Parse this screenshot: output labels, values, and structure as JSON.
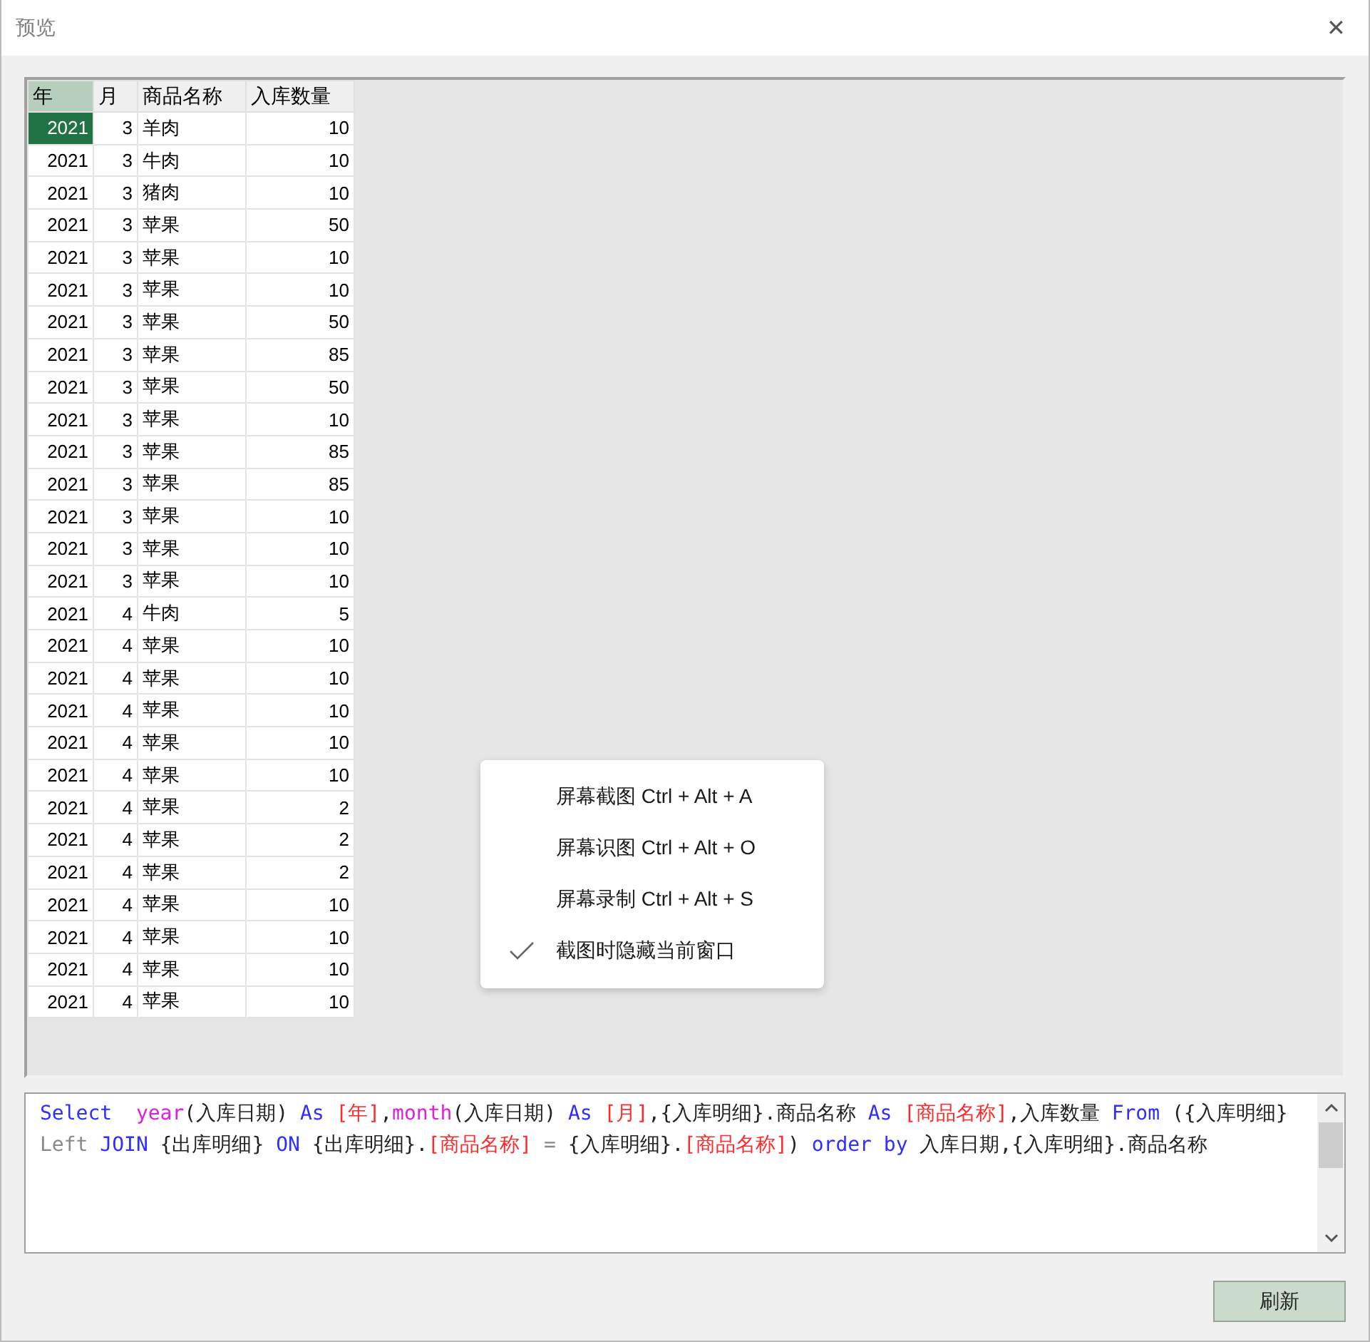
{
  "window": {
    "title": "预览",
    "close": "✕"
  },
  "table": {
    "columns": [
      {
        "label": "年",
        "selected": true
      },
      {
        "label": "月",
        "selected": false
      },
      {
        "label": "商品名称",
        "selected": false
      },
      {
        "label": "入库数量",
        "selected": false
      }
    ],
    "rows": [
      {
        "cells": [
          "2021",
          "3",
          "羊肉",
          "10"
        ],
        "selected": true
      },
      {
        "cells": [
          "2021",
          "3",
          "牛肉",
          "10"
        ],
        "selected": false
      },
      {
        "cells": [
          "2021",
          "3",
          "猪肉",
          "10"
        ],
        "selected": false
      },
      {
        "cells": [
          "2021",
          "3",
          "苹果",
          "50"
        ],
        "selected": false
      },
      {
        "cells": [
          "2021",
          "3",
          "苹果",
          "10"
        ],
        "selected": false
      },
      {
        "cells": [
          "2021",
          "3",
          "苹果",
          "10"
        ],
        "selected": false
      },
      {
        "cells": [
          "2021",
          "3",
          "苹果",
          "50"
        ],
        "selected": false
      },
      {
        "cells": [
          "2021",
          "3",
          "苹果",
          "85"
        ],
        "selected": false
      },
      {
        "cells": [
          "2021",
          "3",
          "苹果",
          "50"
        ],
        "selected": false
      },
      {
        "cells": [
          "2021",
          "3",
          "苹果",
          "10"
        ],
        "selected": false
      },
      {
        "cells": [
          "2021",
          "3",
          "苹果",
          "85"
        ],
        "selected": false
      },
      {
        "cells": [
          "2021",
          "3",
          "苹果",
          "85"
        ],
        "selected": false
      },
      {
        "cells": [
          "2021",
          "3",
          "苹果",
          "10"
        ],
        "selected": false
      },
      {
        "cells": [
          "2021",
          "3",
          "苹果",
          "10"
        ],
        "selected": false
      },
      {
        "cells": [
          "2021",
          "3",
          "苹果",
          "10"
        ],
        "selected": false
      },
      {
        "cells": [
          "2021",
          "4",
          "牛肉",
          "5"
        ],
        "selected": false
      },
      {
        "cells": [
          "2021",
          "4",
          "苹果",
          "10"
        ],
        "selected": false
      },
      {
        "cells": [
          "2021",
          "4",
          "苹果",
          "10"
        ],
        "selected": false
      },
      {
        "cells": [
          "2021",
          "4",
          "苹果",
          "10"
        ],
        "selected": false
      },
      {
        "cells": [
          "2021",
          "4",
          "苹果",
          "10"
        ],
        "selected": false
      },
      {
        "cells": [
          "2021",
          "4",
          "苹果",
          "10"
        ],
        "selected": false
      },
      {
        "cells": [
          "2021",
          "4",
          "苹果",
          "2"
        ],
        "selected": false
      },
      {
        "cells": [
          "2021",
          "4",
          "苹果",
          "2"
        ],
        "selected": false
      },
      {
        "cells": [
          "2021",
          "4",
          "苹果",
          "2"
        ],
        "selected": false
      },
      {
        "cells": [
          "2021",
          "4",
          "苹果",
          "10"
        ],
        "selected": false
      },
      {
        "cells": [
          "2021",
          "4",
          "苹果",
          "10"
        ],
        "selected": false
      },
      {
        "cells": [
          "2021",
          "4",
          "苹果",
          "10"
        ],
        "selected": false
      },
      {
        "cells": [
          "2021",
          "4",
          "苹果",
          "10"
        ],
        "selected": false
      }
    ]
  },
  "context_menu": [
    {
      "label": "屏幕截图 Ctrl + Alt + A",
      "checked": false
    },
    {
      "label": "屏幕识图 Ctrl + Alt + O",
      "checked": false
    },
    {
      "label": "屏幕录制 Ctrl + Alt + S",
      "checked": false
    },
    {
      "label": "截图时隐藏当前窗口",
      "checked": true
    }
  ],
  "sql_editor": {
    "tokens": [
      {
        "text": "Select  ",
        "kind": "keyword"
      },
      {
        "text": "year",
        "kind": "function"
      },
      {
        "text": "(入库日期) ",
        "kind": "plain"
      },
      {
        "text": "As ",
        "kind": "keyword"
      },
      {
        "text": "[年]",
        "kind": "field"
      },
      {
        "text": ",",
        "kind": "plain"
      },
      {
        "text": "month",
        "kind": "function"
      },
      {
        "text": "(入库日期) ",
        "kind": "plain"
      },
      {
        "text": "As ",
        "kind": "keyword"
      },
      {
        "text": "[月]",
        "kind": "field"
      },
      {
        "text": ",{入库明细}.商品名称 ",
        "kind": "plain"
      },
      {
        "text": "As ",
        "kind": "keyword"
      },
      {
        "text": "[商品名称]",
        "kind": "field"
      },
      {
        "text": ",入库数量 ",
        "kind": "plain"
      },
      {
        "text": "From",
        "kind": "keyword"
      },
      {
        "text": " ({入库明细} ",
        "kind": "plain"
      },
      {
        "text": "Left ",
        "kind": "muted"
      },
      {
        "text": "JOIN",
        "kind": "keyword"
      },
      {
        "text": " {出库明细} ",
        "kind": "plain"
      },
      {
        "text": "ON",
        "kind": "keyword"
      },
      {
        "text": " {出库明细}.",
        "kind": "plain"
      },
      {
        "text": "[商品名称] ",
        "kind": "field"
      },
      {
        "text": "=",
        "kind": "muted"
      },
      {
        "text": " {入库明细}.",
        "kind": "plain"
      },
      {
        "text": "[商品名称]",
        "kind": "field"
      },
      {
        "text": ") ",
        "kind": "plain"
      },
      {
        "text": "order by",
        "kind": "keyword"
      },
      {
        "text": " 入库日期,{入库明细}.商品名称",
        "kind": "plain"
      }
    ]
  },
  "buttons": [
    {
      "label": "刷新"
    }
  ]
}
